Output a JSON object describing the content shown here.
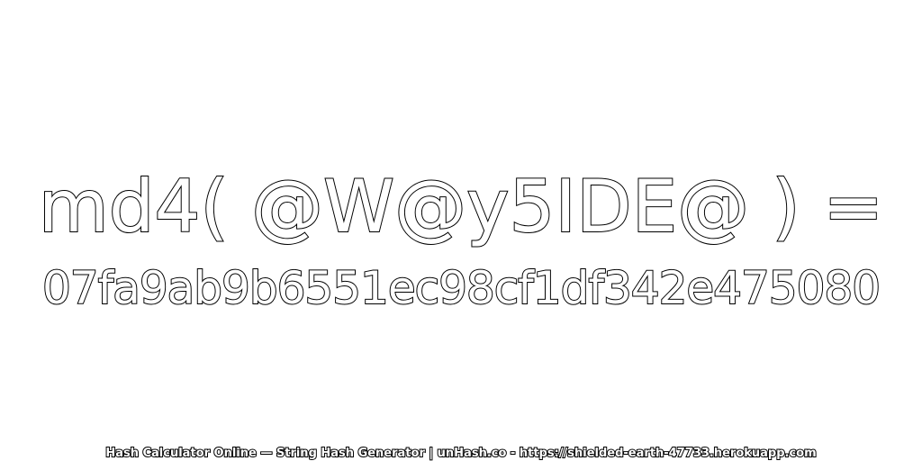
{
  "hash_expression": "md4( @W@y5IDE@ ) =",
  "hash_value": "07fa9ab9b6551ec98cf1df342e475080",
  "footer_text": "Hash Calculator Online — String Hash Generator | unHash.co - https://shielded-earth-47733.herokuapp.com",
  "colors": {
    "text_fill": "#ffffff",
    "text_stroke": "#000000",
    "background": "#ffffff"
  }
}
